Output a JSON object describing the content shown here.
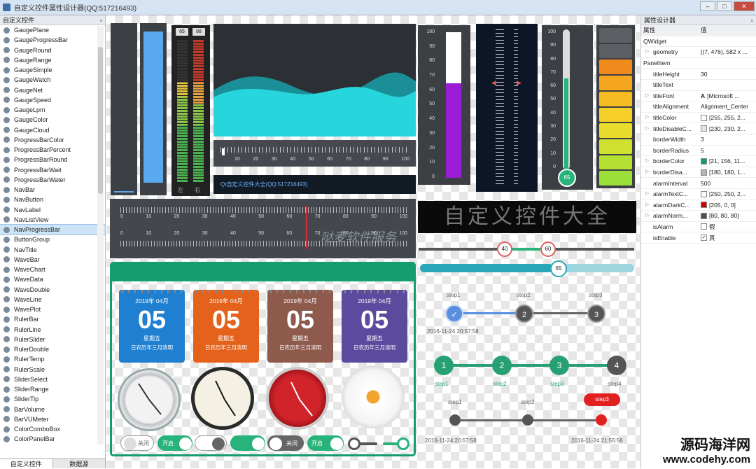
{
  "window": {
    "title": "自定义控件属性设计器(QQ:517216493)",
    "min": "–",
    "max": "□",
    "close": "✕"
  },
  "left_panel": {
    "title": "自定义控件",
    "pin": "▫",
    "items": [
      "GaugePlane",
      "GaugeProgressBar",
      "GaugeRound",
      "GaugeRange",
      "GaugeSimple",
      "GaugeWatch",
      "GaugeNet",
      "GaugeSpeed",
      "GaugeLpm",
      "GaugeColor",
      "GaugeCloud",
      "ProgressBarColor",
      "ProgressBarPercent",
      "ProgressBarRound",
      "ProgressBarWait",
      "ProgressBarWater",
      "NavBar",
      "NavButton",
      "NavLabel",
      "NavListView",
      "NavProgressBar",
      "ButtonGroup",
      "NavTitle",
      "WaveBar",
      "WaveChart",
      "WaveData",
      "WaveDouble",
      "WaveLine",
      "WavePlot",
      "RulerBar",
      "RulerLine",
      "RulerSlider",
      "RulerDouble",
      "RulerTemp",
      "RulerScale",
      "SliderSelect",
      "SliderRange",
      "SliderTip",
      "BarVolume",
      "BarVUMeter",
      "ColorComboBox",
      "ColorPanelBar"
    ],
    "selected": "NavProgressBar",
    "tabs": [
      "自定义控件",
      "数据源"
    ]
  },
  "meters": {
    "left_levels": [
      "65",
      "88"
    ],
    "left_tags": [
      "左",
      "右"
    ]
  },
  "wave_panel": {
    "ruler_ticks": [
      "10",
      "20",
      "30",
      "40",
      "50",
      "60",
      "70",
      "80",
      "90",
      "100"
    ],
    "label": "Qt自定义控件大全(QQ:517216493)"
  },
  "tank": {
    "ticks": [
      "100",
      "90",
      "80",
      "70",
      "60",
      "50",
      "40",
      "30",
      "20",
      "10",
      "0"
    ],
    "value": 0.65
  },
  "thermo": {
    "ticks": [
      "100",
      "90",
      "80",
      "70",
      "60",
      "50",
      "40",
      "30",
      "20",
      "10",
      "0"
    ],
    "value": "65"
  },
  "ruler_double": {
    "ticks": [
      "0",
      "10",
      "20",
      "30",
      "40",
      "50",
      "60",
      "70",
      "80",
      "90",
      "100"
    ]
  },
  "led_text": "自定义控件大全",
  "watermark_mid": "哒麦软件服务",
  "range_slider": {
    "low": "40",
    "high": "60"
  },
  "tip_slider": {
    "value": "65"
  },
  "calendars": [
    {
      "month": "2019年 04月",
      "day": "05",
      "week": "星期五",
      "note": "已农历年三月清明",
      "color": "#1f7fd0"
    },
    {
      "month": "2019年 04月",
      "day": "05",
      "week": "星期五",
      "note": "已农历年三月清明",
      "color": "#e4621b"
    },
    {
      "month": "2019年 04月",
      "day": "05",
      "week": "星期五",
      "note": "已农历年三月清明",
      "color": "#8d5a4c"
    },
    {
      "month": "2019年 04月",
      "day": "05",
      "week": "星期五",
      "note": "已农历年三月清明",
      "color": "#5b4a9e"
    }
  ],
  "toggles": [
    {
      "text": "关闭"
    },
    {
      "text": "开启"
    },
    {
      "text": ""
    },
    {
      "text": ""
    },
    {
      "text": "关闭"
    },
    {
      "text": "开启"
    },
    {
      "text": ""
    },
    {
      "text": ""
    }
  ],
  "steps1": {
    "labels": [
      "step1",
      "step2",
      "step3"
    ],
    "nums": [
      "✓",
      "2",
      "3"
    ],
    "date": "2016-11-24 20:57:58"
  },
  "steps2": {
    "labels": [
      "step1",
      "step2",
      "step3",
      "step4"
    ],
    "nums": [
      "1",
      "2",
      "3",
      "4"
    ]
  },
  "steps3": {
    "labels": [
      "step1",
      "step2",
      "step3"
    ],
    "date_left": "2016-11-24 20:57:58",
    "date_right": "2016-11-24 21:55:56"
  },
  "property_panel": {
    "title": "属性设计器",
    "pin": "▫",
    "col_key": "属性",
    "col_val": "值",
    "rows": [
      {
        "k": "QWidget",
        "v": "",
        "cat": true
      },
      {
        "k": "geometry",
        "v": "[(7, 476), 582 x ...",
        "arrow": true
      },
      {
        "k": "PanelItem",
        "v": "",
        "cat": true
      },
      {
        "k": "titleHeight",
        "v": "30"
      },
      {
        "k": "titleText",
        "v": ""
      },
      {
        "k": "titleFont",
        "v": "[Microsoft ...",
        "arrow": true,
        "font": "A"
      },
      {
        "k": "titleAlignment",
        "v": "Alignment_Center"
      },
      {
        "k": "titleColor",
        "v": "[255, 255, 2...",
        "arrow": true,
        "sw": "#ffffff"
      },
      {
        "k": "titleDisableC...",
        "v": "[230, 230, 2...",
        "arrow": true,
        "sw": "#e6e6e6"
      },
      {
        "k": "borderWidth",
        "v": "3"
      },
      {
        "k": "borderRadius",
        "v": "5"
      },
      {
        "k": "borderColor",
        "v": "[21, 156, 11...",
        "arrow": true,
        "sw": "#159c6f"
      },
      {
        "k": "borderDisa...",
        "v": "[180, 180, 1...",
        "arrow": true,
        "sw": "#b4b4b4"
      },
      {
        "k": "alarmInterval",
        "v": "500"
      },
      {
        "k": "alarmTextC...",
        "v": "[250, 250, 2...",
        "arrow": true,
        "sw": "#fafafa"
      },
      {
        "k": "alarmDarkC...",
        "v": "[205, 0, 0]",
        "arrow": true,
        "sw": "#cd0000"
      },
      {
        "k": "alarmNorm...",
        "v": "[80, 80, 80]",
        "arrow": true,
        "sw": "#505050"
      },
      {
        "k": "isAlarm",
        "v": "假",
        "check": false
      },
      {
        "k": "isEnable",
        "v": "真",
        "check": true
      }
    ]
  },
  "corner_watermark": {
    "line1": "源码海洋网",
    "line2": "www.codehy.com"
  }
}
